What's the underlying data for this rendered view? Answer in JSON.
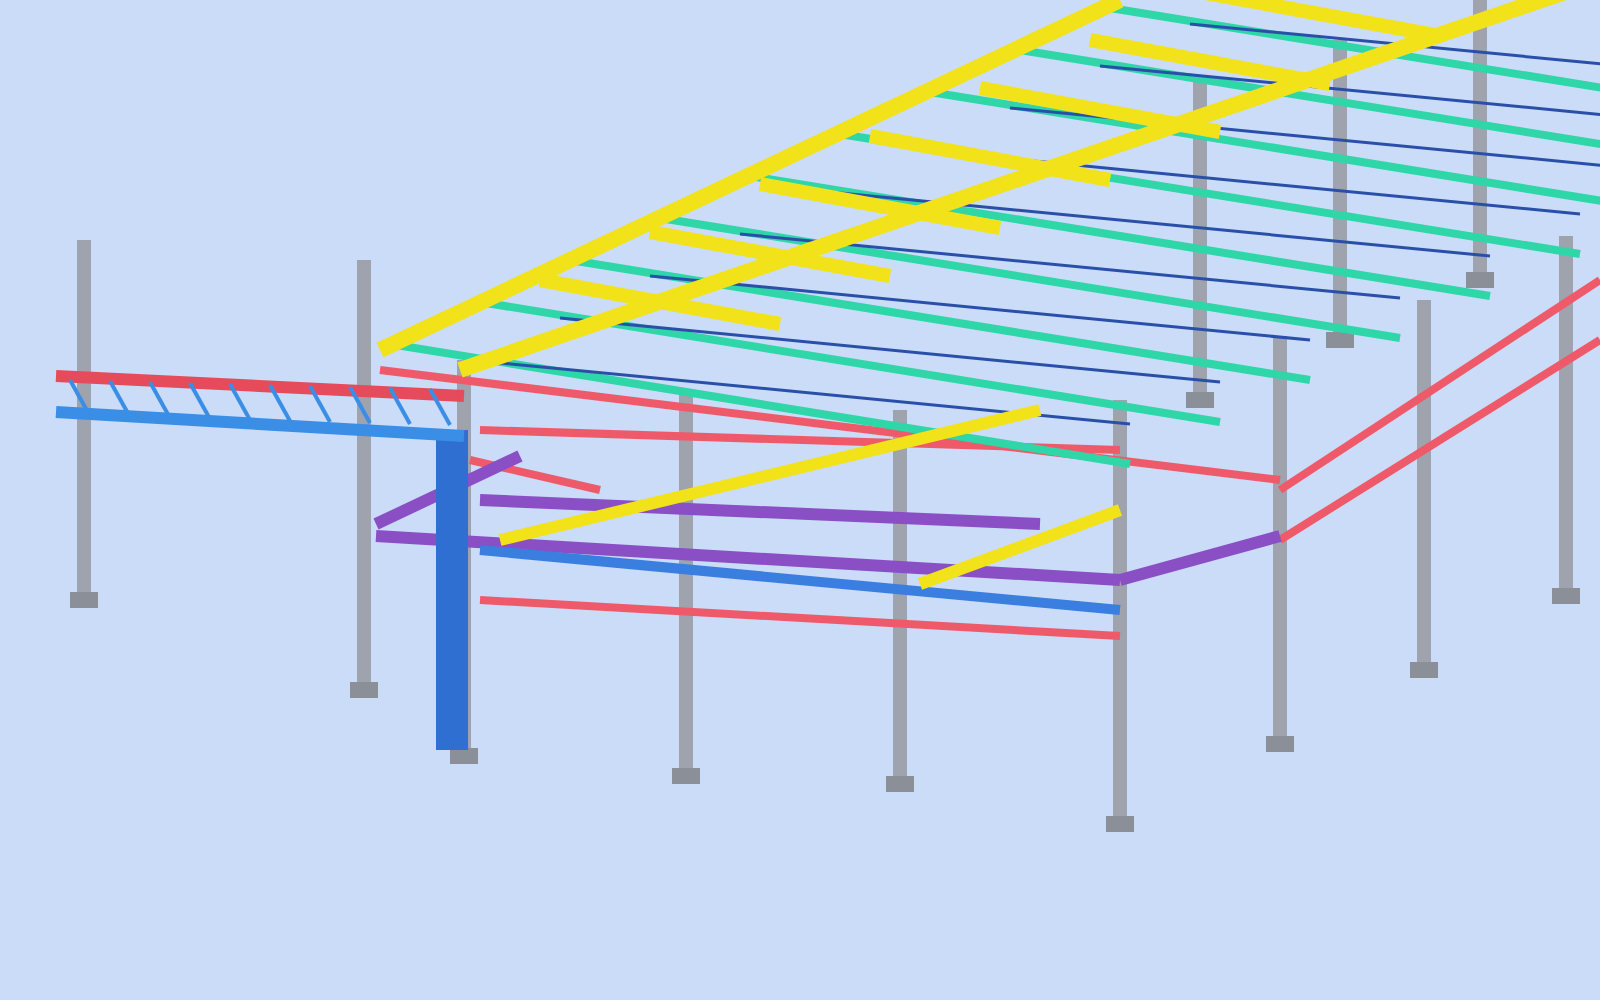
{
  "viewport": {
    "kind": "steel-frame-model"
  }
}
